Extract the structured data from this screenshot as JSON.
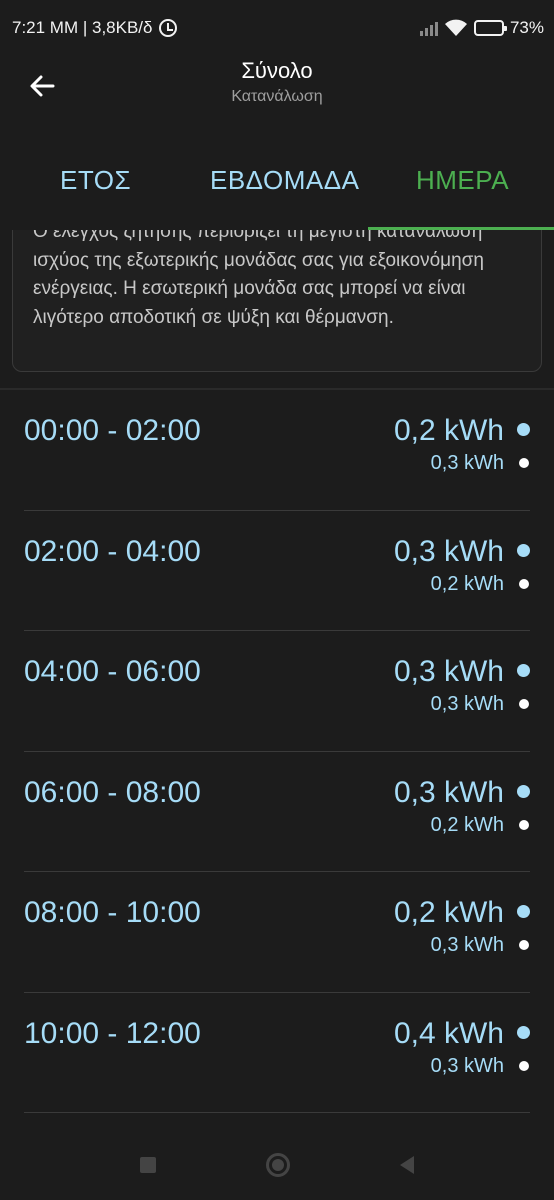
{
  "status_bar": {
    "left_text": "7:21 ΜΜ | 3,8KB/δ",
    "battery_text": "73%",
    "battery_level": 0.73,
    "icons": [
      "alarm-icon",
      "signal-icon",
      "wifi-icon",
      "battery-icon"
    ]
  },
  "header": {
    "title": "Σύνολο",
    "subtitle": "Κατανάλωση",
    "back_icon": "arrow-left-icon"
  },
  "tabs": {
    "year": "ΕΤΟΣ",
    "week": "ΕΒΔΟΜΑΔΑ",
    "day": "ΗΜΕΡΑ",
    "selected": "day"
  },
  "info": {
    "text": "Ο έλεγχος ζήτησης περιορίζει τη μέγιστη κατανάλωση ισχύος της εξωτερικής μονάδας σας για εξοικονόμηση ενέργειας. Η εσωτερική μονάδα σας μπορεί να είναι λιγότερο αποδοτική σε ψύξη και θέρμανση."
  },
  "rows": [
    {
      "time": "00:00 - 02:00",
      "value_primary": "0,2 kWh",
      "value_secondary": "0,3 kWh"
    },
    {
      "time": "02:00 - 04:00",
      "value_primary": "0,3 kWh",
      "value_secondary": "0,2 kWh"
    },
    {
      "time": "04:00 - 06:00",
      "value_primary": "0,3 kWh",
      "value_secondary": "0,3 kWh"
    },
    {
      "time": "06:00 - 08:00",
      "value_primary": "0,3 kWh",
      "value_secondary": "0,2 kWh"
    },
    {
      "time": "08:00 - 10:00",
      "value_primary": "0,2 kWh",
      "value_secondary": "0,3 kWh"
    },
    {
      "time": "10:00 - 12:00",
      "value_primary": "0,4 kWh",
      "value_secondary": "0,3 kWh"
    }
  ],
  "colors": {
    "background": "#1c1c1c",
    "accent_blue": "#a6dcf7",
    "accent_green": "#4caf50",
    "secondary_dot": "#ffffff"
  },
  "nav_bar": {
    "icons": [
      "recents-icon",
      "home-icon",
      "back-icon"
    ]
  }
}
